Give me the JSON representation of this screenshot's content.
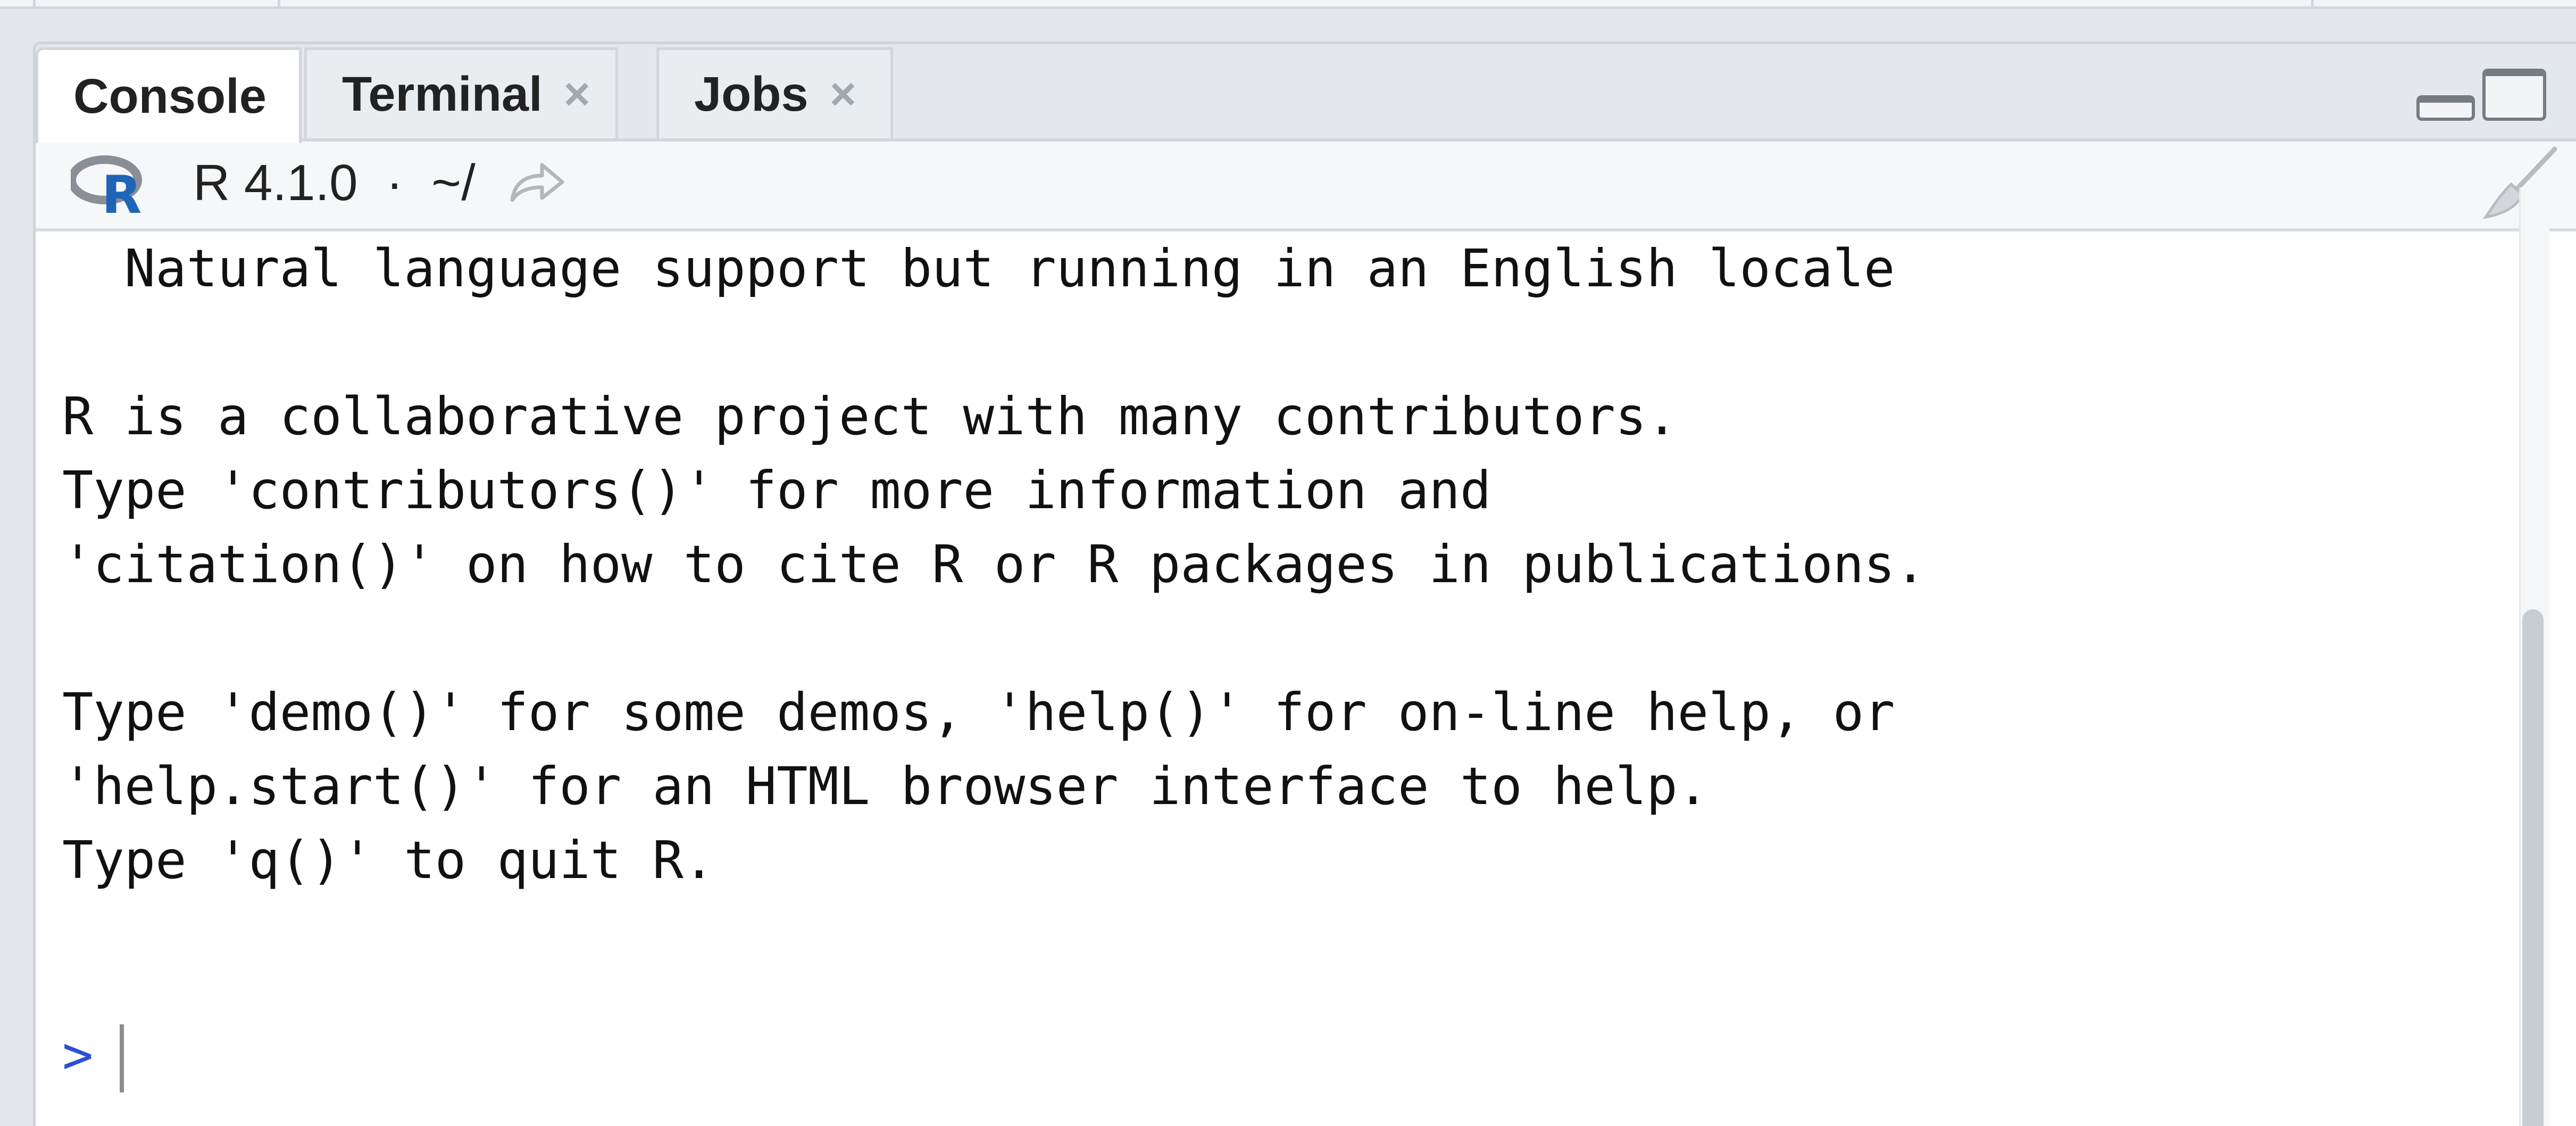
{
  "tabs": [
    {
      "label": "Console",
      "active": true,
      "closable": false
    },
    {
      "label": "Terminal",
      "active": false,
      "closable": true
    },
    {
      "label": "Jobs",
      "active": false,
      "closable": true
    }
  ],
  "close_glyph": "×",
  "toolbar": {
    "r_version": "R 4.1.0",
    "separator": "·",
    "working_dir": "~/"
  },
  "console": {
    "lines": [
      "  Natural language support but running in an English locale",
      "",
      "R is a collaborative project with many contributors.",
      "Type 'contributors()' for more information and",
      "'citation()' on how to cite R or R packages in publications.",
      "",
      "Type 'demo()' for some demos, 'help()' for on-line help, or",
      "'help.start()' for an HTML browser interface to help.",
      "Type 'q()' to quit R."
    ],
    "prompt": ">"
  },
  "colors": {
    "prompt": "#2a4fd6",
    "r_logo_ring": "#8a8f96",
    "r_logo_letter": "#1f65b7"
  },
  "icons": {
    "r_logo": "r-logo-icon",
    "goto_dir": "goto-directory-icon",
    "clear": "broom-icon",
    "minimize": "minimize-pane-icon",
    "maximize": "maximize-pane-icon"
  }
}
